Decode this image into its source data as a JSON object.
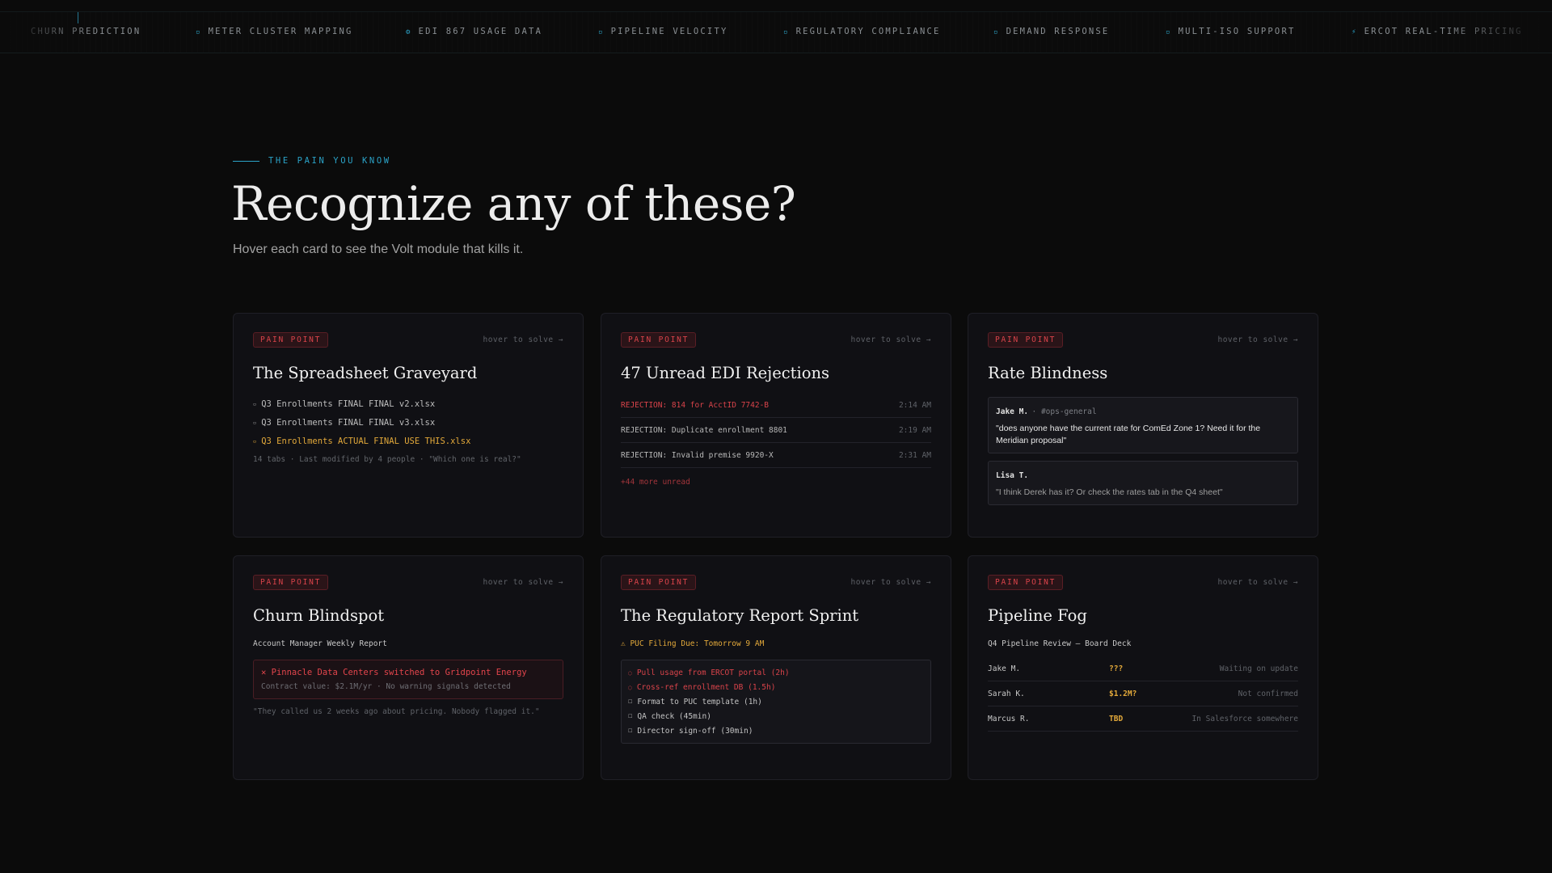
{
  "ticker": {
    "items": [
      {
        "icon": "none",
        "label": "CHURN PREDICTION"
      },
      {
        "icon": "grid-icon",
        "label": "METER CLUSTER MAPPING"
      },
      {
        "icon": "gear-icon",
        "label": "EDI 867 USAGE DATA"
      },
      {
        "icon": "grid-icon",
        "label": "PIPELINE VELOCITY"
      },
      {
        "icon": "grid-icon",
        "label": "REGULATORY COMPLIANCE"
      },
      {
        "icon": "grid-icon",
        "label": "DEMAND RESPONSE"
      },
      {
        "icon": "grid-icon",
        "label": "MULTI-ISO SUPPORT"
      },
      {
        "icon": "bolt-icon",
        "label": "ERCOT REAL-TIME PRICING"
      }
    ]
  },
  "hero": {
    "eyebrow": "THE PAIN YOU KNOW",
    "title": "Recognize any of these?",
    "subtitle": "Hover each card to see the Volt module that kills it."
  },
  "common": {
    "badge": "PAIN POINT",
    "hover_hint": "hover to solve →"
  },
  "cards": {
    "spreadsheet": {
      "title": "The Spreadsheet Graveyard",
      "files": [
        "Q3 Enrollments FINAL FINAL v2.xlsx",
        "Q3 Enrollments FINAL FINAL v3.xlsx",
        "Q3 Enrollments ACTUAL FINAL USE THIS.xlsx"
      ],
      "note": "14 tabs · Last modified by 4 people · \"Which one is real?\""
    },
    "edi": {
      "title": "47 Unread EDI Rejections",
      "rows": [
        {
          "msg": "REJECTION: 814 for AcctID 7742-B",
          "time": "2:14 AM"
        },
        {
          "msg": "REJECTION: Duplicate enrollment 8801",
          "time": "2:19 AM"
        },
        {
          "msg": "REJECTION: Invalid premise 9920-X",
          "time": "2:31 AM"
        }
      ],
      "more": "+44 more unread"
    },
    "rate": {
      "title": "Rate Blindness",
      "msg1": {
        "who": "Jake M.",
        "channel": "· #ops-general",
        "text": "\"does anyone have the current rate for ComEd Zone 1? Need it for the Meridian proposal\""
      },
      "msg2": {
        "who": "Lisa T.",
        "text": "\"I think Derek has it? Or check the rates tab in the Q4 sheet\""
      }
    },
    "churn": {
      "title": "Churn Blindspot",
      "report": "Account Manager Weekly Report",
      "alert": "✕ Pinnacle Data Centers switched to Gridpoint Energy",
      "alert_sub": "Contract value: $2.1M/yr · No warning signals detected",
      "quote": "\"They called us 2 weeks ago about pricing. Nobody flagged it.\""
    },
    "regulatory": {
      "title": "The Regulatory Report Sprint",
      "due": "⚠ PUC Filing Due: Tomorrow 9 AM",
      "tasks": [
        {
          "text": "Pull usage from ERCOT portal (2h)",
          "warn": true
        },
        {
          "text": "Cross-ref enrollment DB (1.5h)",
          "warn": true
        },
        {
          "text": "Format to PUC template (1h)",
          "warn": false
        },
        {
          "text": "QA check (45min)",
          "warn": false
        },
        {
          "text": "Director sign-off (30min)",
          "warn": false
        }
      ]
    },
    "pipeline": {
      "title": "Pipeline Fog",
      "label": "Q4 Pipeline Review — Board Deck",
      "rows": [
        {
          "name": "Jake M.",
          "value": "???",
          "status": "Waiting on update"
        },
        {
          "name": "Sarah K.",
          "value": "$1.2M?",
          "status": "Not confirmed"
        },
        {
          "name": "Marcus R.",
          "value": "TBD",
          "status": "In Salesforce somewhere"
        }
      ]
    }
  },
  "colors": {
    "accent": "#2ba3c8",
    "danger": "#d9434a",
    "warning": "#e3a93a",
    "background": "#0b0b0b",
    "card": "#101014"
  }
}
